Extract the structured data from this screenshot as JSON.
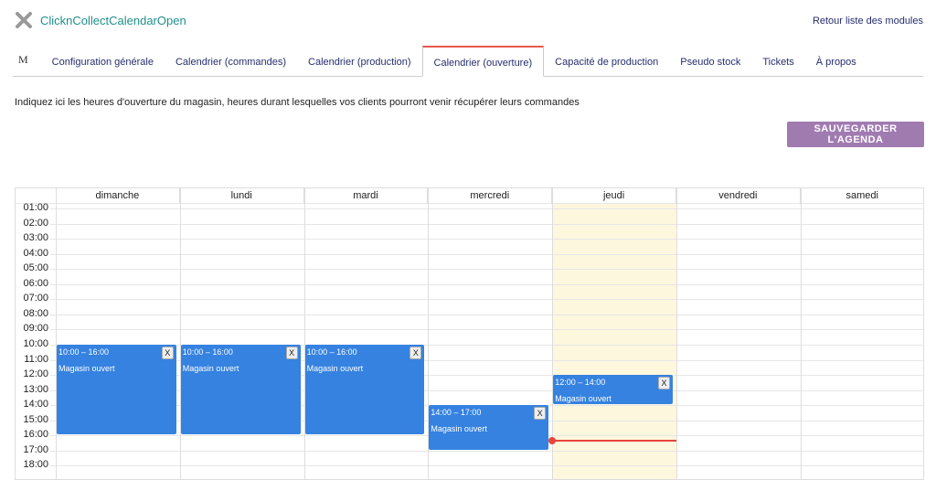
{
  "header": {
    "title": "ClicknCollectCalendarOpen",
    "back_link": "Retour liste des modules",
    "logo_icon": "tools-icon"
  },
  "tabs": [
    {
      "label": "M"
    },
    {
      "label": "Configuration générale"
    },
    {
      "label": "Calendrier (commandes)"
    },
    {
      "label": "Calendrier (production)"
    },
    {
      "label": "Calendrier (ouverture)",
      "active": true
    },
    {
      "label": "Capacité de production"
    },
    {
      "label": "Pseudo stock"
    },
    {
      "label": "Tickets"
    },
    {
      "label": "À propos"
    }
  ],
  "intro": "Indiquez ici les heures d'ouverture du magasin, heures durant lesquelles vos clients pourront venir récupérer leurs commandes",
  "save_label": "SAUVEGARDER L'AGENDA",
  "calendar": {
    "days": [
      "dimanche",
      "lundi",
      "mardi",
      "mercredi",
      "jeudi",
      "vendredi",
      "samedi"
    ],
    "today_index": 4,
    "now_hour": 16.3,
    "hours": [
      "01:00",
      "02:00",
      "03:00",
      "04:00",
      "05:00",
      "06:00",
      "07:00",
      "08:00",
      "09:00",
      "10:00",
      "11:00",
      "12:00",
      "13:00",
      "14:00",
      "15:00",
      "16:00",
      "17:00",
      "18:00"
    ],
    "events": [
      {
        "day": 0,
        "start": 10,
        "end": 16,
        "time": "10:00 – 16:00",
        "title": "Magasin ouvert",
        "close": "X"
      },
      {
        "day": 1,
        "start": 10,
        "end": 16,
        "time": "10:00 – 16:00",
        "title": "Magasin ouvert",
        "close": "X"
      },
      {
        "day": 2,
        "start": 10,
        "end": 16,
        "time": "10:00 – 16:00",
        "title": "Magasin ouvert",
        "close": "X"
      },
      {
        "day": 3,
        "start": 14,
        "end": 17,
        "time": "14:00 – 17:00",
        "title": "Magasin ouvert",
        "close": "X"
      },
      {
        "day": 4,
        "start": 12,
        "end": 14,
        "time": "12:00 – 14:00",
        "title": "Magasin ouvert",
        "close": "X"
      }
    ],
    "colors": {
      "event": "#3582e0",
      "today": "#fdf7dd",
      "now": "#e8453c"
    }
  }
}
